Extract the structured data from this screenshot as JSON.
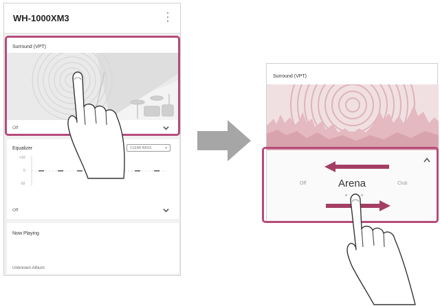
{
  "left_phone": {
    "app_title": "WH-1000XM3",
    "surround": {
      "label": "Surround (VPT)",
      "value": "Off"
    },
    "equalizer": {
      "label": "Equalizer",
      "preset_pill": "CLEAR BASS",
      "scale_labels": [
        "+10",
        "0",
        "-10"
      ],
      "value": "Off"
    },
    "now_playing": {
      "label": "Now Playing",
      "album": "Unknown Album"
    }
  },
  "right_phone": {
    "surround_label": "Surround (VPT)",
    "options": {
      "left": "Off",
      "selected": "Arena",
      "right": "Club"
    }
  },
  "colors": {
    "highlight": "#b54b7a",
    "arrow_gray": "#a6a6a6",
    "scene_pink": "#e4b9c0"
  }
}
